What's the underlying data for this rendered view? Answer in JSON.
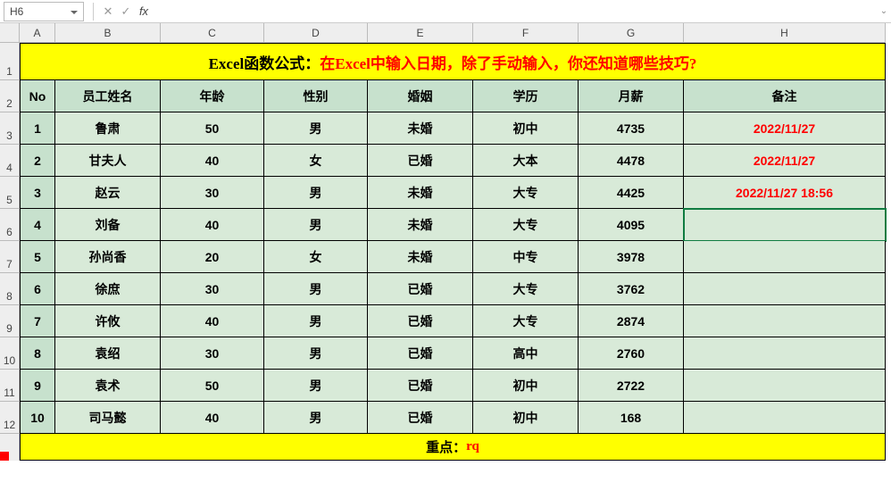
{
  "formulaBar": {
    "nameBox": "H6",
    "cancel": "✕",
    "confirm": "✓",
    "fx": "fx",
    "value": ""
  },
  "columns": [
    "A",
    "B",
    "C",
    "D",
    "E",
    "F",
    "G",
    "H"
  ],
  "rowNumbers": [
    "1",
    "2",
    "3",
    "4",
    "5",
    "6",
    "7",
    "8",
    "9",
    "10",
    "11",
    "12"
  ],
  "title": {
    "black": "Excel函数公式：",
    "red": "在Excel中输入日期，除了手动输入，你还知道哪些技巧?"
  },
  "headers": [
    "No",
    "员工姓名",
    "年龄",
    "性别",
    "婚姻",
    "学历",
    "月薪",
    "备注"
  ],
  "rows": [
    {
      "no": "1",
      "name": "鲁肃",
      "age": "50",
      "sex": "男",
      "mar": "未婚",
      "edu": "初中",
      "sal": "4735",
      "note": "2022/11/27"
    },
    {
      "no": "2",
      "name": "甘夫人",
      "age": "40",
      "sex": "女",
      "mar": "已婚",
      "edu": "大本",
      "sal": "4478",
      "note": "2022/11/27"
    },
    {
      "no": "3",
      "name": "赵云",
      "age": "30",
      "sex": "男",
      "mar": "未婚",
      "edu": "大专",
      "sal": "4425",
      "note": "2022/11/27 18:56"
    },
    {
      "no": "4",
      "name": "刘备",
      "age": "40",
      "sex": "男",
      "mar": "未婚",
      "edu": "大专",
      "sal": "4095",
      "note": ""
    },
    {
      "no": "5",
      "name": "孙尚香",
      "age": "20",
      "sex": "女",
      "mar": "未婚",
      "edu": "中专",
      "sal": "3978",
      "note": ""
    },
    {
      "no": "6",
      "name": "徐庶",
      "age": "30",
      "sex": "男",
      "mar": "已婚",
      "edu": "大专",
      "sal": "3762",
      "note": ""
    },
    {
      "no": "7",
      "name": "许攸",
      "age": "40",
      "sex": "男",
      "mar": "已婚",
      "edu": "大专",
      "sal": "2874",
      "note": ""
    },
    {
      "no": "8",
      "name": "袁绍",
      "age": "30",
      "sex": "男",
      "mar": "已婚",
      "edu": "高中",
      "sal": "2760",
      "note": ""
    },
    {
      "no": "9",
      "name": "袁术",
      "age": "50",
      "sex": "男",
      "mar": "已婚",
      "edu": "初中",
      "sal": "2722",
      "note": ""
    },
    {
      "no": "10",
      "name": "司马懿",
      "age": "40",
      "sex": "男",
      "mar": "已婚",
      "edu": "初中",
      "sal": "168",
      "note": ""
    }
  ],
  "footer": {
    "black": "重点：",
    "red": "rq"
  },
  "selectedCell": "H6"
}
